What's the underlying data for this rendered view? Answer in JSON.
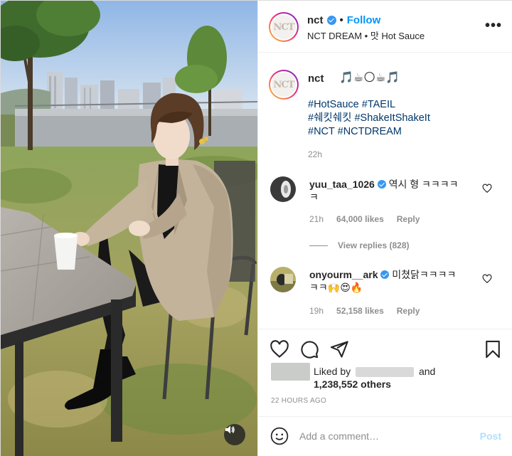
{
  "header": {
    "username": "nct",
    "follow_label": "Follow",
    "dot": "•",
    "audio": "NCT DREAM • 맛 Hot Sauce",
    "more": "•••",
    "avatar_text": "NCT"
  },
  "caption": {
    "username": "nct",
    "emoji": "🎵☕🌕☕🎵",
    "tags": [
      "#HotSauce #TAEIL",
      "#쉐킷쉐킷 #ShakeItShakeIt",
      "#NCT #NCTDREAM"
    ],
    "time": "22h"
  },
  "comments": [
    {
      "username": "yuu_taa_1026",
      "text_line1": "역시 형 ㅋㅋㅋㅋ",
      "text_line2": "ㅋ",
      "time": "21h",
      "likes": "64,000 likes",
      "reply_label": "Reply"
    },
    {
      "username": "onyourm__ark",
      "text_line1": "미쳤닭ㅋㅋㅋㅋ",
      "text_line2": "ㅋㅋ🙌😍🔥",
      "time": "19h",
      "likes": "52,158 likes",
      "reply_label": "Reply"
    }
  ],
  "view_replies": "View replies (828)",
  "likes": {
    "liked_by": "Liked by",
    "and": "and",
    "others": "1,238,552 others"
  },
  "post_time": "22 HOURS AGO",
  "add_comment": {
    "placeholder": "Add a comment…",
    "post_label": "Post"
  },
  "icons": {
    "more": "more-options-icon",
    "heart": "heart-icon",
    "comment": "comment-icon",
    "share": "share-icon",
    "save": "bookmark-icon",
    "emoji": "emoji-icon",
    "sound": "speaker-icon",
    "verified": "verified-badge-icon"
  },
  "colors": {
    "accent": "#0095f6",
    "hashtag": "#00376b",
    "meta": "#8e8e8e",
    "post_disabled": "#b2dffc"
  }
}
